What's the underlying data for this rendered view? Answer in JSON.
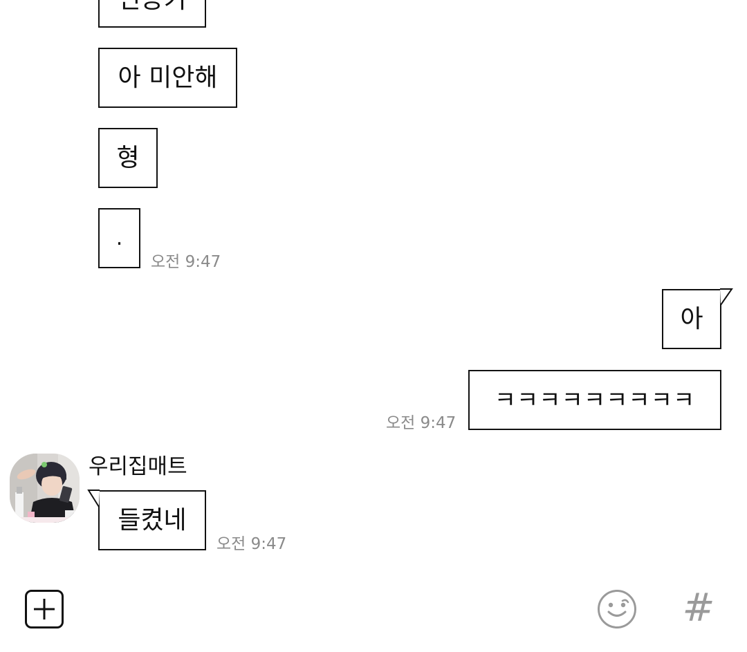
{
  "messages": [
    {
      "id": "m1",
      "side": "received",
      "text": "인증키",
      "time": ""
    },
    {
      "id": "m2",
      "side": "received",
      "text": "아 미안해",
      "time": ""
    },
    {
      "id": "m3",
      "side": "received",
      "text": "형",
      "time": ""
    },
    {
      "id": "m4",
      "side": "received",
      "text": ".",
      "time": "오전 9:47"
    },
    {
      "id": "m5",
      "side": "sent",
      "text": "아",
      "time": ""
    },
    {
      "id": "m6",
      "side": "sent",
      "text": "ㅋㅋㅋㅋㅋㅋㅋㅋㅋ",
      "time": "오전 9:47"
    },
    {
      "id": "m7",
      "side": "received",
      "sender": "우리집매트",
      "text": "들켰네",
      "time": "오전 9:47"
    }
  ],
  "input_bar": {
    "attach_icon": "plus-square-icon",
    "emoji_icon": "smiley-icon",
    "hashtag_icon": "hashtag-icon",
    "hashtag_glyph": "#"
  },
  "colors": {
    "background": "#ffffff",
    "bubble_border": "#111111",
    "timestamp": "#8a8a8a",
    "icon_gray": "#9a9a9a"
  }
}
